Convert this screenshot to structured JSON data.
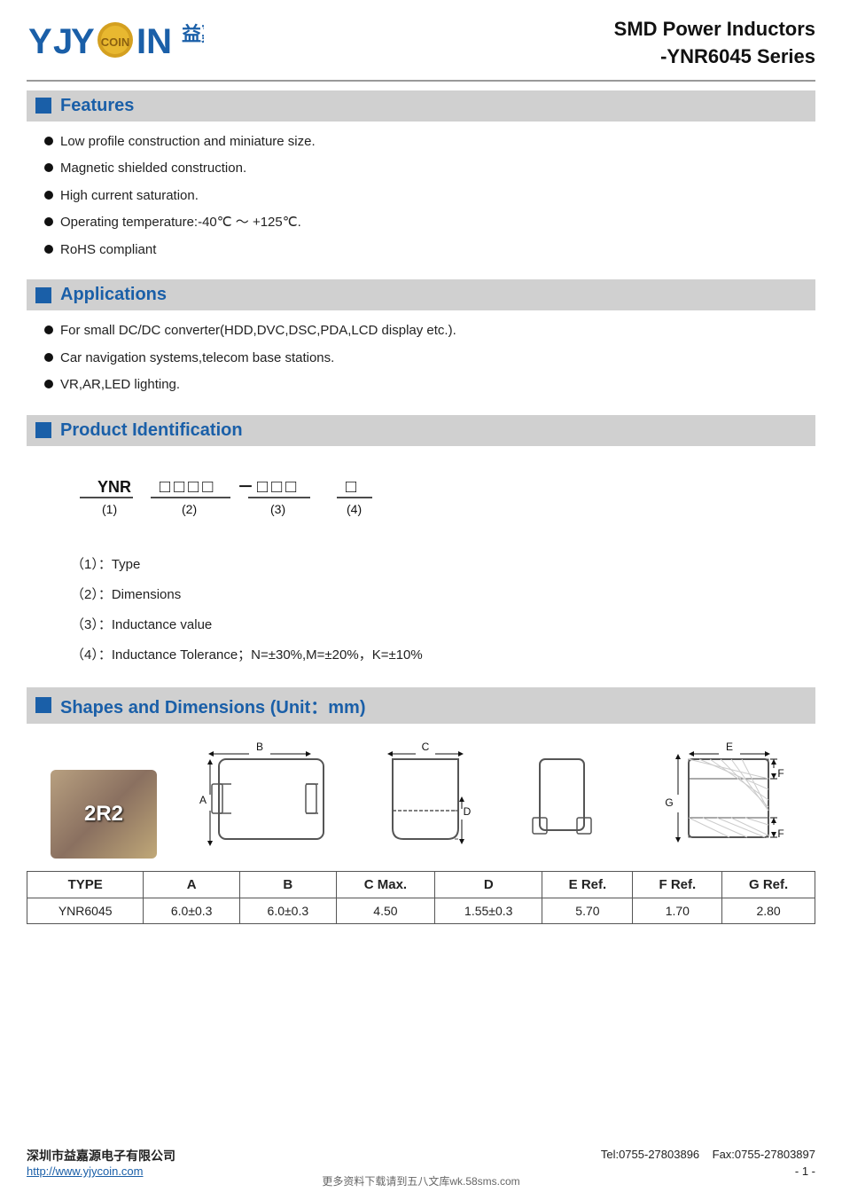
{
  "header": {
    "logo_text": "YJYCOIN",
    "logo_cn": "益嘉源",
    "title_line1": "SMD Power Inductors",
    "title_line2": "-YNR6045 Series"
  },
  "features": {
    "section_label": "Features",
    "items": [
      "Low profile construction and miniature size.",
      "Magnetic shielded construction.",
      "High current saturation.",
      "Operating temperature:-40℃ ～ +125℃.",
      "RoHS compliant"
    ]
  },
  "applications": {
    "section_label": "Applications",
    "items": [
      "For small DC/DC converter(HDD,DVC,DSC,PDA,LCD display etc.).",
      "Car navigation systems,telecom base stations.",
      "VR,AR,LED lighting."
    ]
  },
  "product_id": {
    "section_label": "Product Identification",
    "part1_label": "YNR",
    "part1_num": "(1)",
    "part2_boxes": "□□□□",
    "part2_num": "(2)",
    "part3_boxes": "□□□",
    "part3_num": "(3)",
    "part4_box": "□",
    "part4_num": "(4)",
    "annotations": [
      {
        "num": "（1）：",
        "text": "Type"
      },
      {
        "num": "（2）：",
        "text": "Dimensions"
      },
      {
        "num": "（3）：",
        "text": "Inductance value"
      },
      {
        "num": "（4）：",
        "text": "Inductance Tolerance；N=±30%,M=±20%，K=±10%"
      }
    ]
  },
  "shapes": {
    "section_label": "Shapes and Dimensions (Unit：mm)",
    "photo_label": "2R2",
    "table": {
      "headers": [
        "TYPE",
        "A",
        "B",
        "C Max.",
        "D",
        "E Ref.",
        "F Ref.",
        "G Ref."
      ],
      "rows": [
        [
          "YNR6045",
          "6.0±0.3",
          "6.0±0.3",
          "4.50",
          "1.55±0.3",
          "5.70",
          "1.70",
          "2.80"
        ]
      ]
    }
  },
  "footer": {
    "company_name": "深圳市益嘉源电子有限公司",
    "tel": "Tel:0755-27803896",
    "fax": "Fax:0755-27803897",
    "website": "http://www.yjycoin.com",
    "page": "- 1 -",
    "bottom_text": "更多资料下载请到五八文库wk.58sms.com"
  }
}
